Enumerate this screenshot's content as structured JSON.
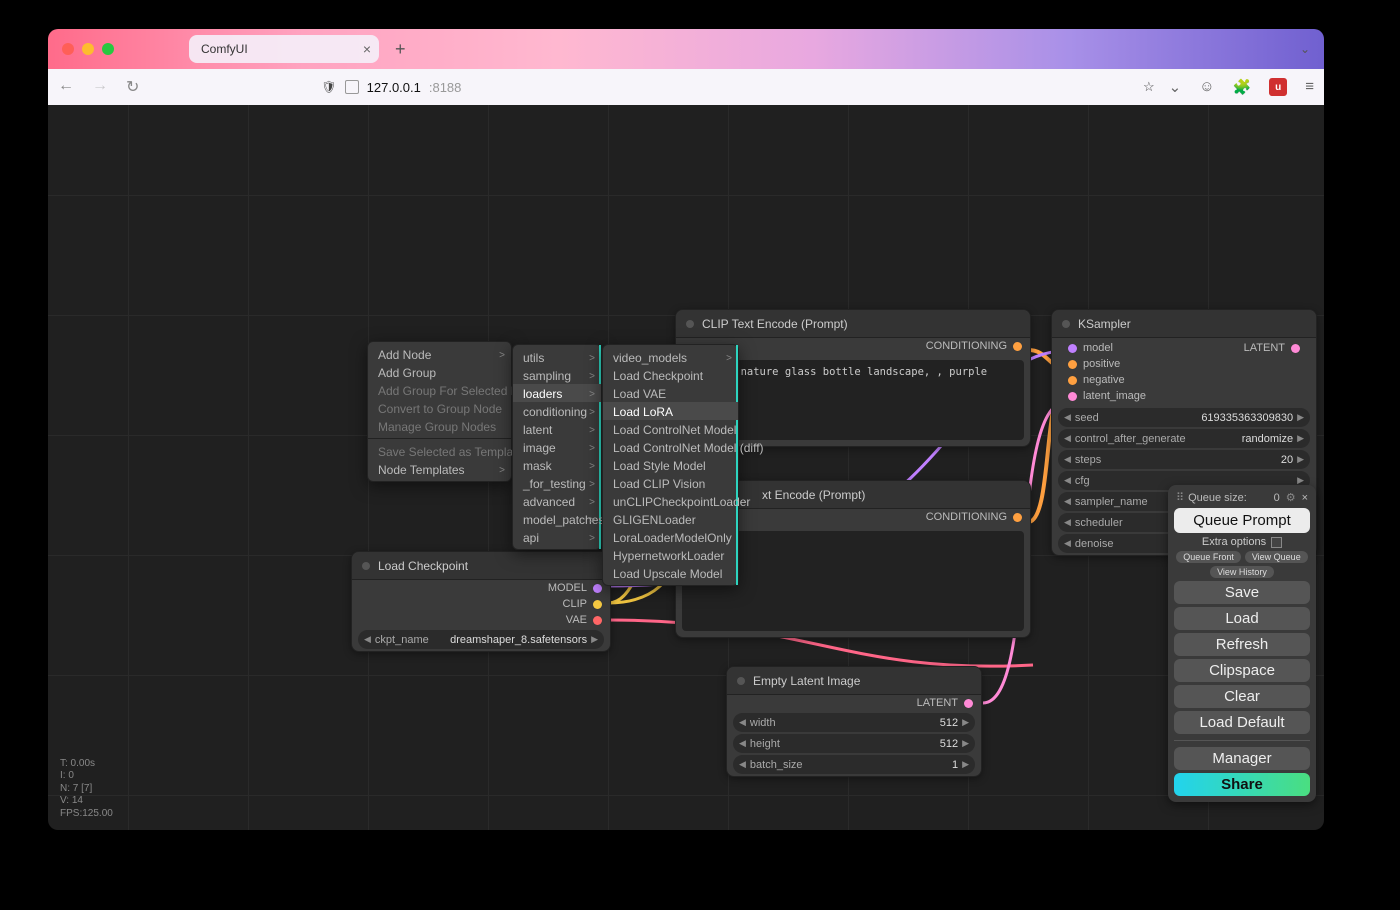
{
  "browser": {
    "tab_title": "ComfyUI",
    "url_host": "127.0.0.1",
    "url_port": ":8188"
  },
  "context_menu_1": {
    "items": [
      {
        "label": "Add Node",
        "sub": true,
        "dim": false
      },
      {
        "label": "Add Group",
        "sub": false,
        "dim": false
      },
      {
        "label": "Add Group For Selected Nodes",
        "sub": false,
        "dim": true
      },
      {
        "label": "Convert to Group Node",
        "sub": false,
        "dim": true
      },
      {
        "label": "Manage Group Nodes",
        "sub": false,
        "dim": true
      },
      {
        "sep": true
      },
      {
        "label": "Save Selected as Template",
        "sub": false,
        "dim": true
      },
      {
        "label": "Node Templates",
        "sub": true,
        "dim": false
      }
    ]
  },
  "context_menu_2": {
    "items": [
      {
        "label": "utils",
        "sub": true
      },
      {
        "label": "sampling",
        "sub": true
      },
      {
        "label": "loaders",
        "sub": true,
        "hl": true
      },
      {
        "label": "conditioning",
        "sub": true
      },
      {
        "label": "latent",
        "sub": true
      },
      {
        "label": "image",
        "sub": true
      },
      {
        "label": "mask",
        "sub": true
      },
      {
        "label": "_for_testing",
        "sub": true
      },
      {
        "label": "advanced",
        "sub": true
      },
      {
        "label": "model_patches",
        "sub": true
      },
      {
        "label": "api",
        "sub": true
      }
    ]
  },
  "context_menu_3": {
    "items": [
      {
        "label": "video_models",
        "sub": true
      },
      {
        "label": "Load Checkpoint"
      },
      {
        "label": "Load VAE"
      },
      {
        "label": "Load LoRA",
        "hl": true
      },
      {
        "label": "Load ControlNet Model"
      },
      {
        "label": "Load ControlNet Model (diff)"
      },
      {
        "label": "Load Style Model"
      },
      {
        "label": "Load CLIP Vision"
      },
      {
        "label": "unCLIPCheckpointLoader"
      },
      {
        "label": "GLIGENLoader"
      },
      {
        "label": "LoraLoaderModelOnly"
      },
      {
        "label": "HypernetworkLoader"
      },
      {
        "label": "Load Upscale Model"
      }
    ]
  },
  "nodes": {
    "load_checkpoint": {
      "title": "Load Checkpoint",
      "outputs": [
        "MODEL",
        "CLIP",
        "VAE"
      ],
      "widget": {
        "name": "ckpt_name",
        "value": "dreamshaper_8.safetensors"
      }
    },
    "clip_pos": {
      "title": "CLIP Text Encode (Prompt)",
      "out": "CONDITIONING",
      "text": "scenery nature glass bottle landscape, , purple galaxy"
    },
    "clip_neg": {
      "title_suffix": "xt Encode (Prompt)",
      "out": "CONDITIONING",
      "text": "mark"
    },
    "empty_latent": {
      "title": "Empty Latent Image",
      "out": "LATENT",
      "widgets": [
        {
          "name": "width",
          "value": "512"
        },
        {
          "name": "height",
          "value": "512"
        },
        {
          "name": "batch_size",
          "value": "1"
        }
      ]
    },
    "ksampler": {
      "title": "KSampler",
      "inputs": [
        "model",
        "positive",
        "negative",
        "latent_image"
      ],
      "out": "LATENT",
      "widgets": [
        {
          "name": "seed",
          "value": "619335363309830"
        },
        {
          "name": "control_after_generate",
          "value": "randomize"
        },
        {
          "name": "steps",
          "value": "20"
        },
        {
          "name": "cfg",
          "value": ""
        },
        {
          "name": "sampler_name",
          "value": ""
        },
        {
          "name": "scheduler",
          "value": ""
        },
        {
          "name": "denoise",
          "value": ""
        }
      ]
    }
  },
  "side_panel": {
    "queue_size_label": "Queue size:",
    "queue_size_value": "0",
    "queue_prompt": "Queue Prompt",
    "extra_options": "Extra options",
    "queue_front": "Queue Front",
    "view_queue": "View Queue",
    "view_history": "View History",
    "buttons": [
      "Save",
      "Load",
      "Refresh",
      "Clipspace",
      "Clear",
      "Load Default"
    ],
    "manager": "Manager",
    "share": "Share"
  },
  "stats": {
    "lines": [
      "T: 0.00s",
      "I: 0",
      "N: 7 [7]",
      "V: 14",
      "FPS:125.00"
    ]
  }
}
